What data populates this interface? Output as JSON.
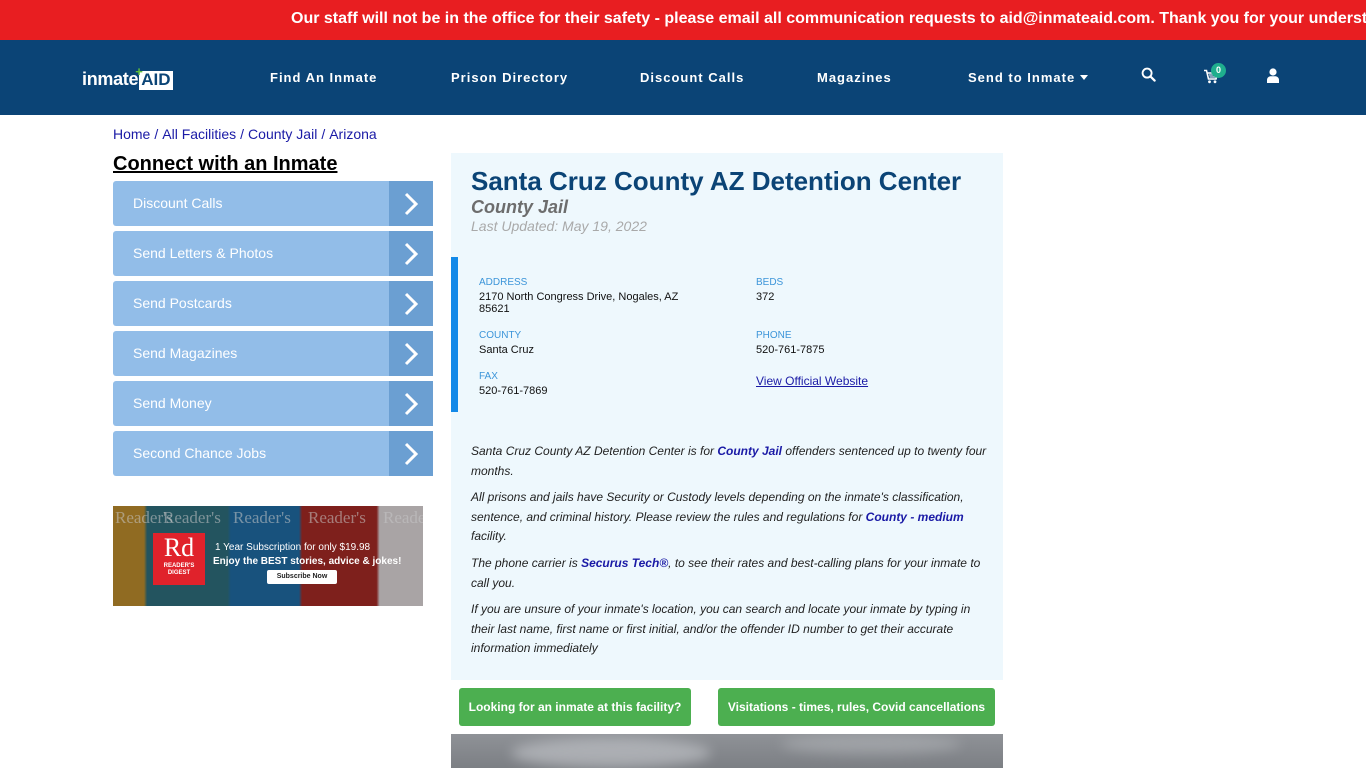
{
  "alert": {
    "text": "Our staff will not be in the office for their safety - please email all communication requests to aid@inmateaid.com. Thank you for your understanding."
  },
  "navbar": {
    "logo": {
      "text": "inmate",
      "accent": "AID"
    },
    "links": [
      {
        "label": "Find An Inmate"
      },
      {
        "label": "Prison Directory"
      },
      {
        "label": "Discount Calls"
      },
      {
        "label": "Magazines"
      },
      {
        "label": "Send to Inmate",
        "has_dropdown": true
      }
    ],
    "icons": [
      "search-icon",
      "cart-icon",
      "user-icon"
    ],
    "cart_count": "0",
    "colors": {
      "background": "#0b4476",
      "badge": "#1fae8d"
    }
  },
  "breadcrumb": [
    {
      "label": "Home"
    },
    {
      "label": "All Facilities"
    },
    {
      "label": "County Jail"
    },
    {
      "label": "Arizona"
    }
  ],
  "breadcrumb_separator": "/",
  "sidebar": {
    "title": "Connect with an Inmate",
    "items": [
      {
        "label": "Discount Calls"
      },
      {
        "label": "Send Letters & Photos"
      },
      {
        "label": "Send Postcards"
      },
      {
        "label": "Send Magazines"
      },
      {
        "label": "Send Money"
      },
      {
        "label": "Second Chance Jobs"
      }
    ],
    "ad": {
      "brand_short": "Rd",
      "brand_name": "READER'S DIGEST",
      "line1": "1 Year Subscription for only $19.98",
      "line2": "Enjoy the BEST stories, advice & jokes!",
      "button": "Subscribe Now",
      "magazine_title": "Reader's"
    }
  },
  "facility": {
    "name": "Santa Cruz County AZ Detention Center",
    "type": "County Jail",
    "last_updated": "Last Updated: May 19, 2022",
    "info": {
      "address_label": "ADDRESS",
      "address_line1": "2170 North Congress Drive, Nogales, AZ",
      "address_line2": "85621",
      "beds_label": "BEDS",
      "beds": "372",
      "county_label": "COUNTY",
      "county": "Santa Cruz",
      "phone_label": "PHONE",
      "phone": "520-761-7875",
      "fax_label": "FAX",
      "fax": "520-761-7869",
      "website_link": "View Official Website"
    },
    "description": {
      "p1_a": "Santa Cruz County AZ Detention Center is for ",
      "p1_link": "County Jail",
      "p1_b": " offenders sentenced up to twenty four months.",
      "p2_a": "All prisons and jails have Security or Custody levels depending on the inmate's classification, sentence, and criminal history. Please review the rules and regulations for ",
      "p2_link": "County - medium",
      "p2_b": " facility.",
      "p3_a": "The phone carrier is ",
      "p3_link": "Securus Tech®",
      "p3_b": ", to see their rates and best-calling plans for your inmate to call you.",
      "p4": "If you are unsure of your inmate's location, you can search and locate your inmate by typing in their last name, first name or first initial, and/or the offender ID number to get their accurate information immediately"
    },
    "buttons": {
      "find_inmate": "Looking for an inmate at this facility?",
      "visitations": "Visitations - times, rules, Covid cancellations"
    }
  }
}
